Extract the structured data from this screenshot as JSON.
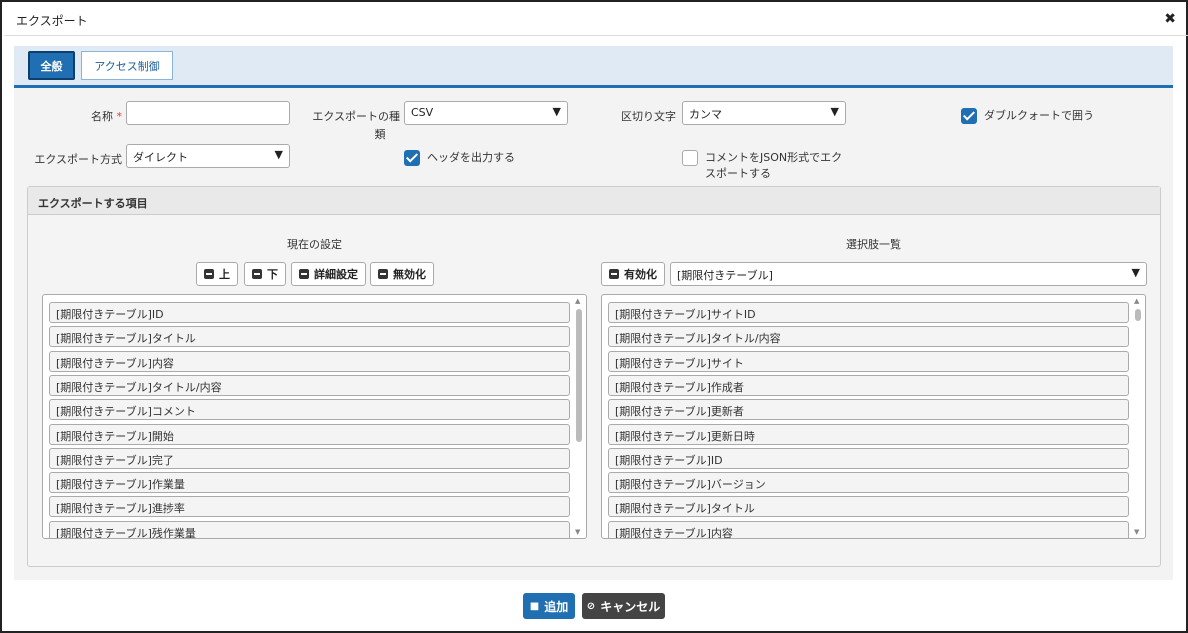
{
  "dialog": {
    "title": "エクスポート",
    "close_symbol": "✖"
  },
  "tabs": [
    {
      "label": "全般",
      "active": true
    },
    {
      "label": "アクセス制御",
      "active": false
    }
  ],
  "form": {
    "name_label": "名称",
    "required_mark": "*",
    "name_value": "",
    "type_label_1": "エクスポートの種",
    "type_label_2": "類",
    "type_value": "CSV",
    "delimiter_label": "区切り文字",
    "delimiter_value": "カンマ",
    "quote_label": "ダブルクォートで囲う",
    "quote_checked": true,
    "method_label": "エクスポート方式",
    "method_value": "ダイレクト",
    "header_label": "ヘッダを出力する",
    "header_checked": true,
    "json_comment_label_1": "コメントをJSON形式でエク",
    "json_comment_label_2": "スポートする",
    "json_comment_checked": false
  },
  "items_panel": {
    "title": "エクスポートする項目",
    "current_title": "現在の設定",
    "choices_title": "選択肢一覧",
    "buttons": {
      "up": "上",
      "down": "下",
      "detail": "詳細設定",
      "disable": "無効化",
      "enable": "有効化"
    },
    "table_select": "[期限付きテーブル]",
    "current_items": [
      "[期限付きテーブル]ID",
      "[期限付きテーブル]タイトル",
      "[期限付きテーブル]内容",
      "[期限付きテーブル]タイトル/内容",
      "[期限付きテーブル]コメント",
      "[期限付きテーブル]開始",
      "[期限付きテーブル]完了",
      "[期限付きテーブル]作業量",
      "[期限付きテーブル]進捗率",
      "[期限付きテーブル]残作業量"
    ],
    "choice_items": [
      "[期限付きテーブル]サイトID",
      "[期限付きテーブル]タイトル/内容",
      "[期限付きテーブル]サイト",
      "[期限付きテーブル]作成者",
      "[期限付きテーブル]更新者",
      "[期限付きテーブル]更新日時",
      "[期限付きテーブル]ID",
      "[期限付きテーブル]バージョン",
      "[期限付きテーブル]タイトル",
      "[期限付きテーブル]内容"
    ]
  },
  "footer": {
    "add": "追加",
    "cancel": "キャンセル"
  },
  "colors": {
    "accent": "#1f6fb2",
    "cancel_bg": "#444444"
  }
}
